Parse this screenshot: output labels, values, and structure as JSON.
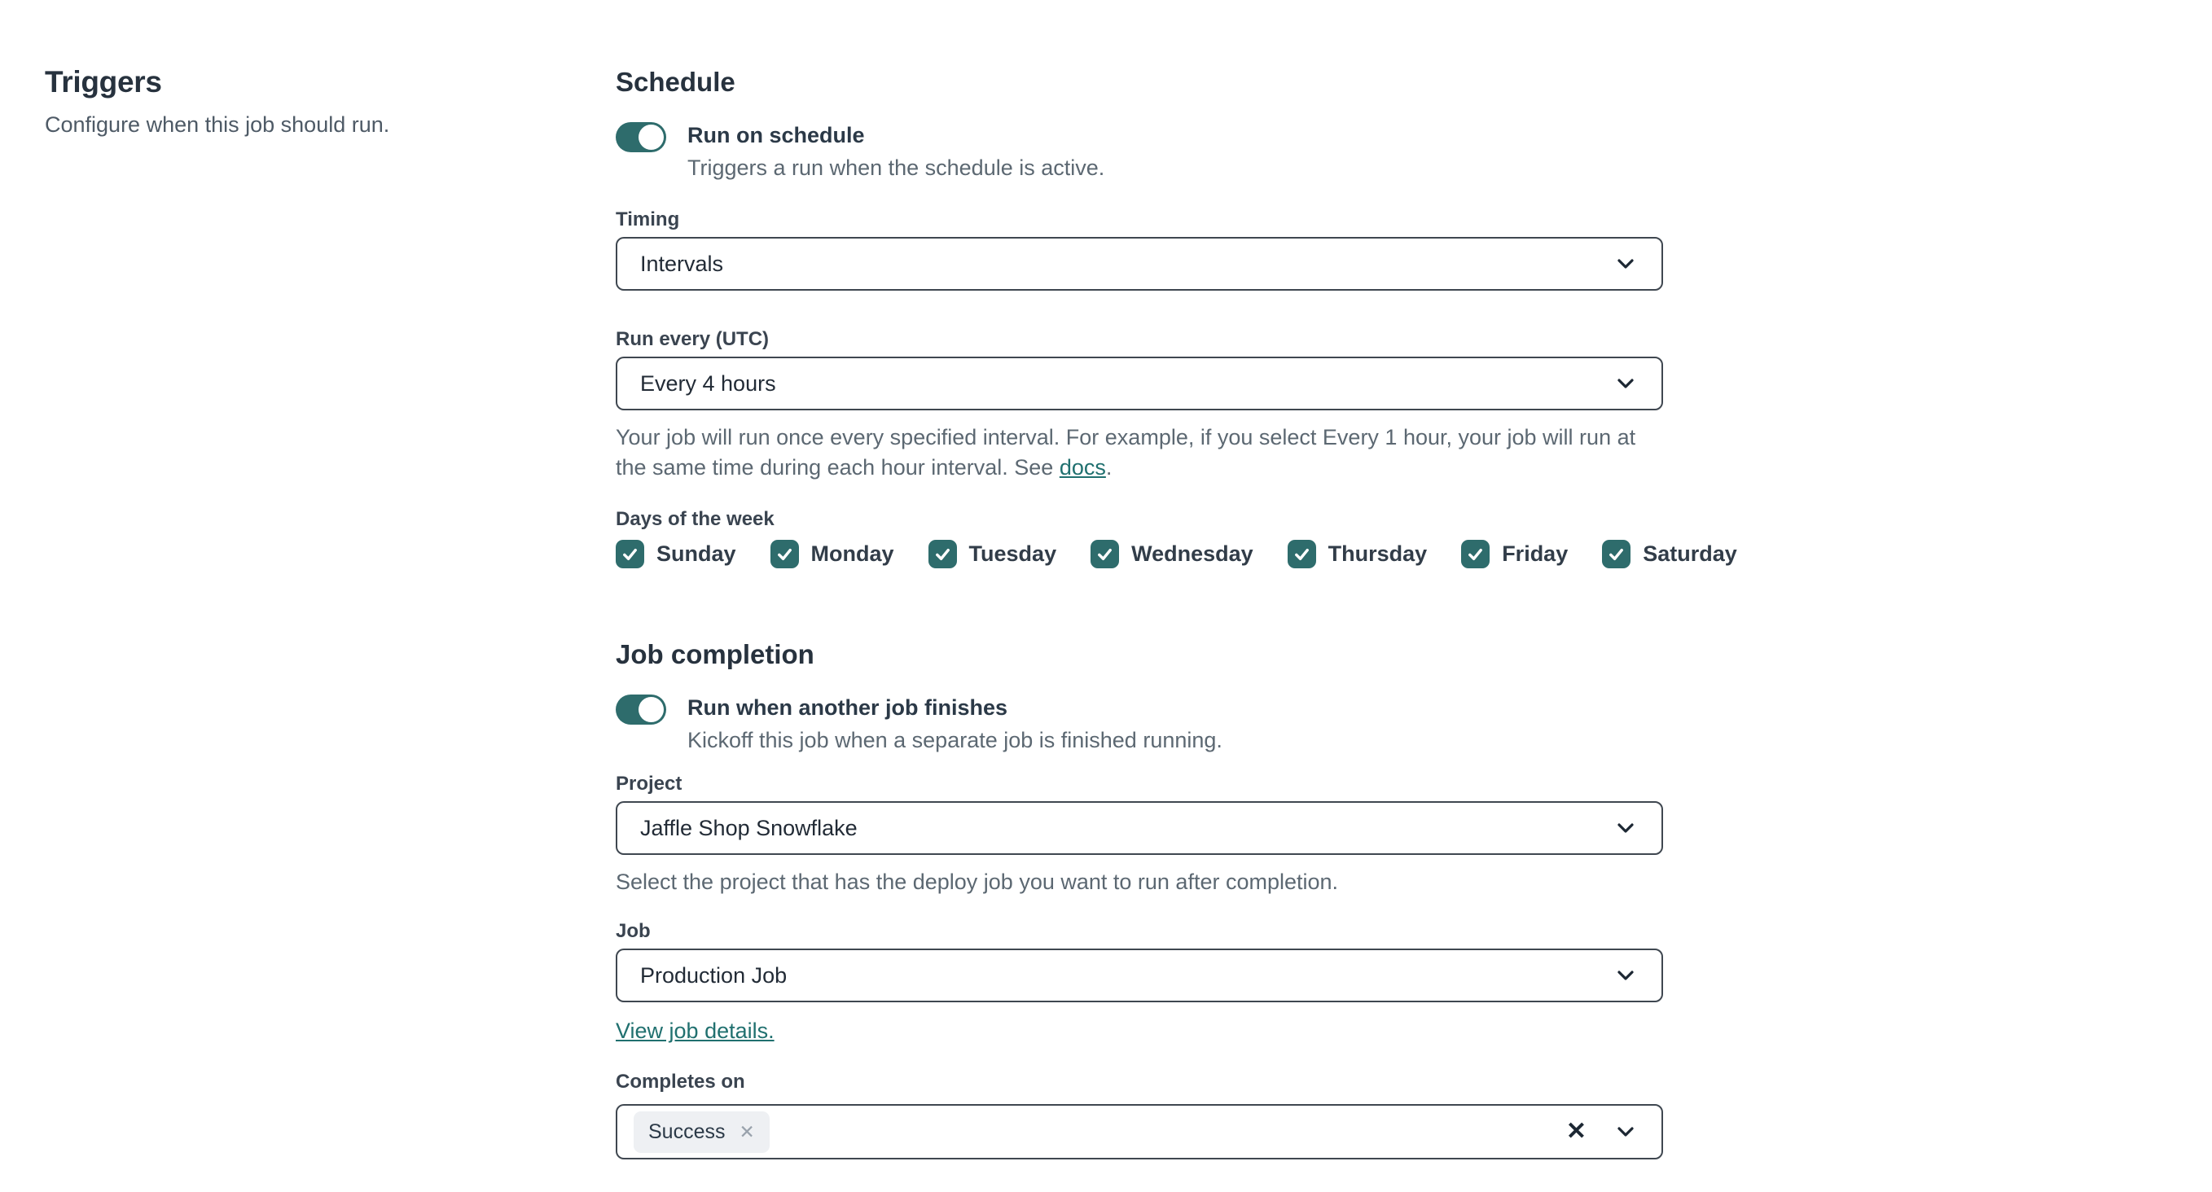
{
  "colors": {
    "accent_teal": "#2e6c6c",
    "link_teal": "#20706f",
    "heading_text": "#27323e",
    "muted_text": "#5c6872",
    "field_border": "#3f4750",
    "chip_background": "#eef0f3"
  },
  "left_panel": {
    "title": "Triggers",
    "subtitle": "Configure when this job should run."
  },
  "schedule": {
    "heading": "Schedule",
    "run_on_schedule": {
      "label": "Run on schedule",
      "description": "Triggers a run when the schedule is active.",
      "state": "on"
    },
    "timing": {
      "label": "Timing",
      "value": "Intervals"
    },
    "run_every": {
      "label": "Run every (UTC)",
      "value": "Every 4 hours",
      "help_before_link": "Your job will run once every specified interval. For example, if you select Every 1 hour, your job will run at the same time during each hour interval. See ",
      "help_link_text": "docs",
      "help_after_link": "."
    },
    "days_of_week": {
      "label": "Days of the week",
      "items": [
        {
          "label": "Sunday",
          "checked": true
        },
        {
          "label": "Monday",
          "checked": true
        },
        {
          "label": "Tuesday",
          "checked": true
        },
        {
          "label": "Wednesday",
          "checked": true
        },
        {
          "label": "Thursday",
          "checked": true
        },
        {
          "label": "Friday",
          "checked": true
        },
        {
          "label": "Saturday",
          "checked": true
        }
      ]
    }
  },
  "job_completion": {
    "heading": "Job completion",
    "run_when_another_job_finishes": {
      "label": "Run when another job finishes",
      "description": "Kickoff this job when a separate job is finished running.",
      "state": "on"
    },
    "project": {
      "label": "Project",
      "value": "Jaffle Shop Snowflake",
      "help": "Select the project that has the deploy job you want to run after completion."
    },
    "job": {
      "label": "Job",
      "value": "Production Job",
      "link_text": "View job details."
    },
    "completes_on": {
      "label": "Completes on",
      "selected": [
        {
          "label": "Success"
        }
      ]
    }
  }
}
